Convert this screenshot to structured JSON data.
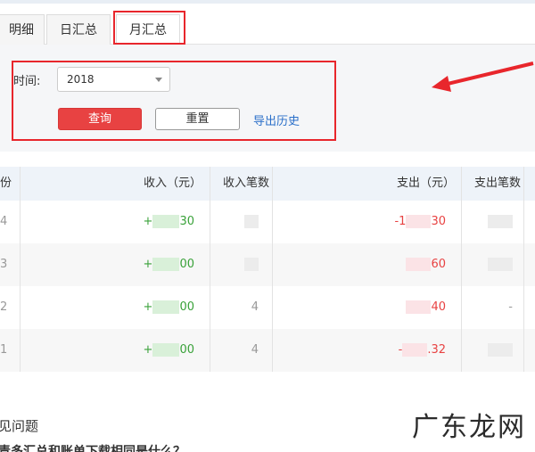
{
  "tabs": [
    {
      "label": "明细"
    },
    {
      "label": "日汇总"
    },
    {
      "label": "月汇总",
      "active": true
    }
  ],
  "filter": {
    "time_label": "时间:",
    "year_value": "2018",
    "query_label": "查询",
    "reset_label": "重置",
    "export_label": "导出历史"
  },
  "table": {
    "headers": {
      "month": "份",
      "income": "收入（元）",
      "income_count": "收入笔数",
      "expense": "支出（元）",
      "expense_count": "支出笔数"
    },
    "rows": [
      {
        "month": "4",
        "income": "+",
        "income_tail": "30",
        "income_count": "",
        "expense": "-1",
        "expense_tail": "30",
        "expense_count": ""
      },
      {
        "month": "3",
        "income": "+",
        "income_tail": "00",
        "income_count": "",
        "expense": "",
        "expense_tail": "60",
        "expense_count": ""
      },
      {
        "month": "2",
        "income": "+",
        "income_tail": "00",
        "income_count": "4",
        "expense": "",
        "expense_tail": "40",
        "expense_count": "-"
      },
      {
        "month": "1",
        "income": "+",
        "income_tail": "00",
        "income_count": "4",
        "expense": "-",
        "expense_tail": ".32",
        "expense_count": ""
      }
    ]
  },
  "faq": {
    "title": "见问题",
    "question": "青多汇总和账单下载相同是什么？"
  },
  "watermark": "广东龙网",
  "colors": {
    "accent_red": "#e84242",
    "link_blue": "#2a6fc9",
    "income_green": "#3aa23a"
  }
}
